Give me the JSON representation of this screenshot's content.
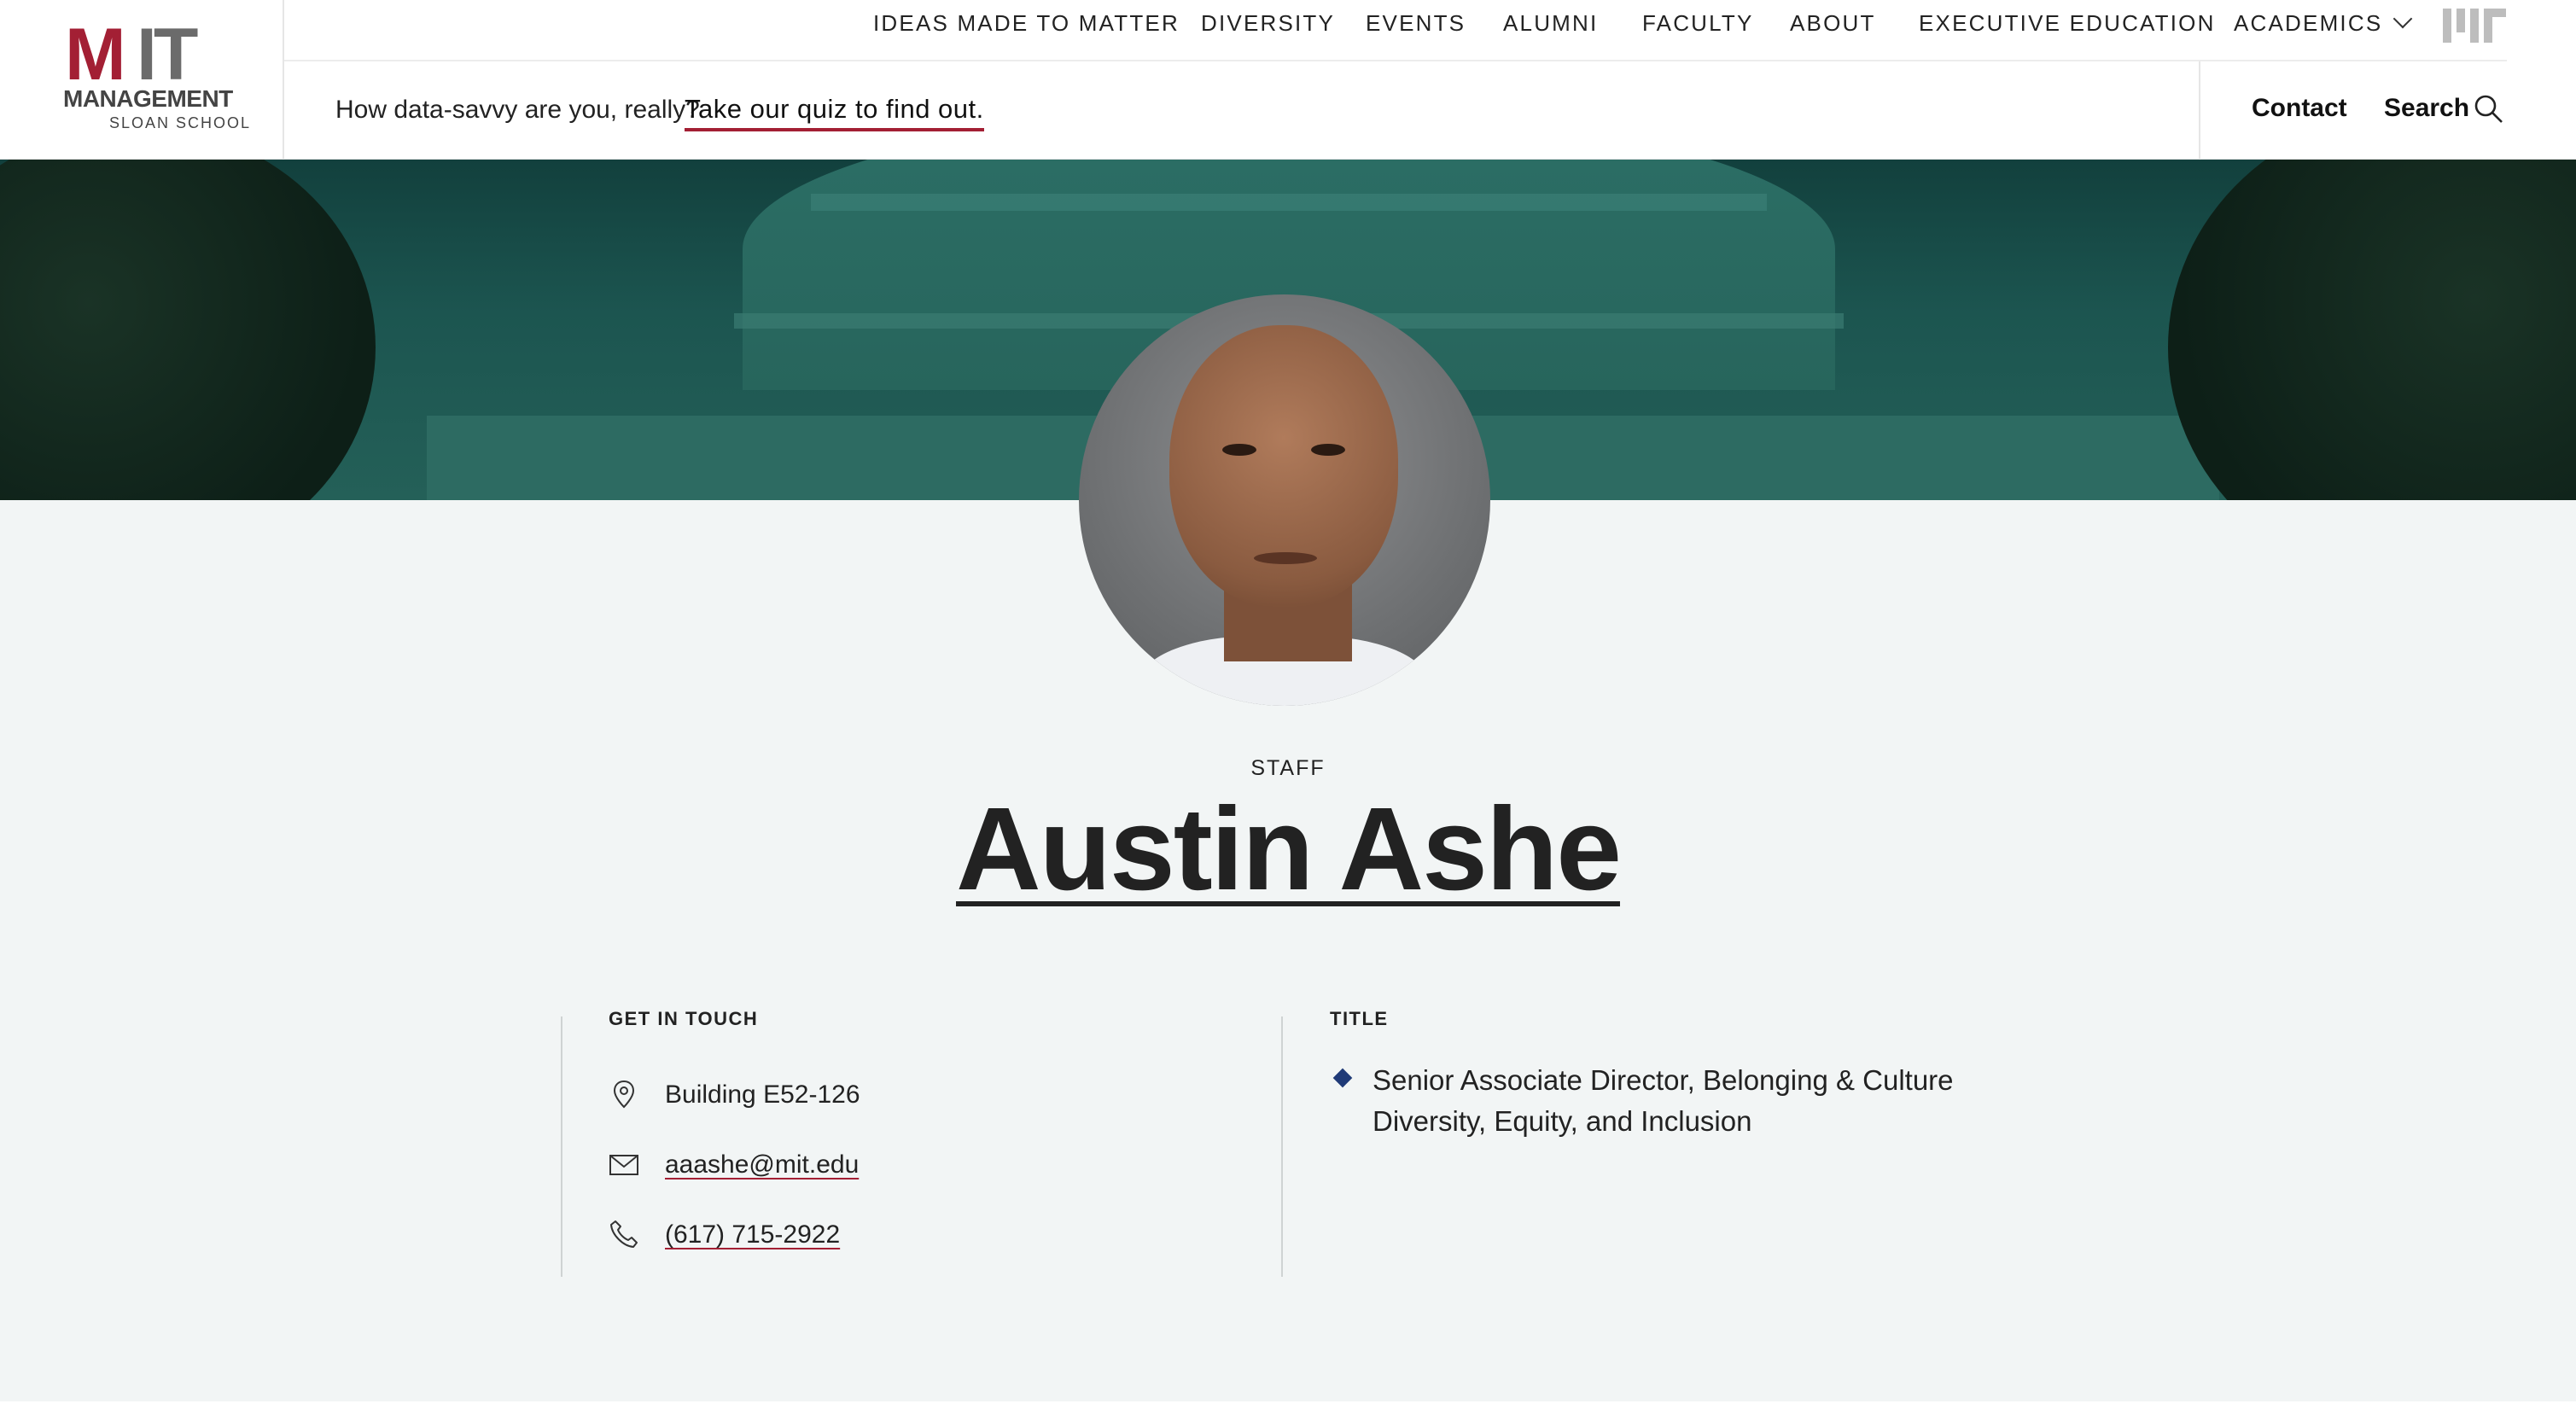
{
  "brand": {
    "logo_text_main": "MIT",
    "logo_text_m": "M",
    "logo_text_it": "IT",
    "logo_line2": "MANAGEMENT",
    "logo_line3": "SLOAN SCHOOL",
    "colors": {
      "cardinal": "#a31f34",
      "gray": "#6b6b6b",
      "navy": "#1f3a77"
    }
  },
  "topnav": {
    "items": [
      {
        "label": "IDEAS MADE TO MATTER"
      },
      {
        "label": "DIVERSITY"
      },
      {
        "label": "EVENTS"
      },
      {
        "label": "ALUMNI"
      },
      {
        "label": "FACULTY"
      },
      {
        "label": "ABOUT"
      },
      {
        "label": "EXECUTIVE EDUCATION"
      },
      {
        "label": "ACADEMICS"
      }
    ],
    "mit_icon": "mit-mini-logo-icon"
  },
  "promo": {
    "text": "How data-savvy are you, really?",
    "link": "Take our quiz to find out."
  },
  "utility": {
    "contact": "Contact",
    "search": "Search",
    "search_icon": "search-icon"
  },
  "profile": {
    "category": "STAFF",
    "name": "Austin Ashe",
    "photo_icon": "profile-photo"
  },
  "get_in_touch": {
    "heading": "GET IN TOUCH",
    "location": {
      "icon": "location-pin-icon",
      "text": "Building E52-126"
    },
    "email": {
      "icon": "envelope-icon",
      "text": "aaashe@mit.edu"
    },
    "phone": {
      "icon": "phone-icon",
      "text": "(617) 715-2922"
    }
  },
  "title_section": {
    "heading": "TITLE",
    "lines": [
      "Senior Associate Director, Belonging & Culture",
      "Diversity, Equity, and Inclusion"
    ]
  }
}
